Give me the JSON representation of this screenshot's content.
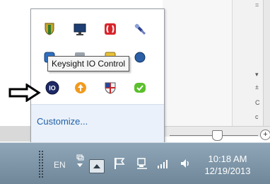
{
  "popup": {
    "tooltip": "Keysight IO Control",
    "customize_label": "Customize..."
  },
  "taskbar": {
    "language": "EN",
    "time": "10:18 AM",
    "date": "12/19/2013"
  },
  "background": {
    "glyphs": [
      "=",
      "–",
      "▾",
      "±",
      "C",
      "c",
      "+"
    ]
  },
  "colors": {
    "link": "#1f5fa8",
    "popup_footer": "#eaf1fa",
    "taskbar": "#7f97aa"
  },
  "tray_icons": [
    "shield-warning-icon",
    "monitor-icon",
    "red-app-icon",
    "satellite-icon",
    "blue-app-icon",
    "gray-app-icon",
    "yellow-app-icon",
    "blue-round-icon",
    "keysight-io-control-icon",
    "orange-update-icon",
    "shield-flag-icon",
    "green-app-icon",
    "flag-icon",
    "network-icon",
    "signal-icon",
    "volume-icon"
  ]
}
